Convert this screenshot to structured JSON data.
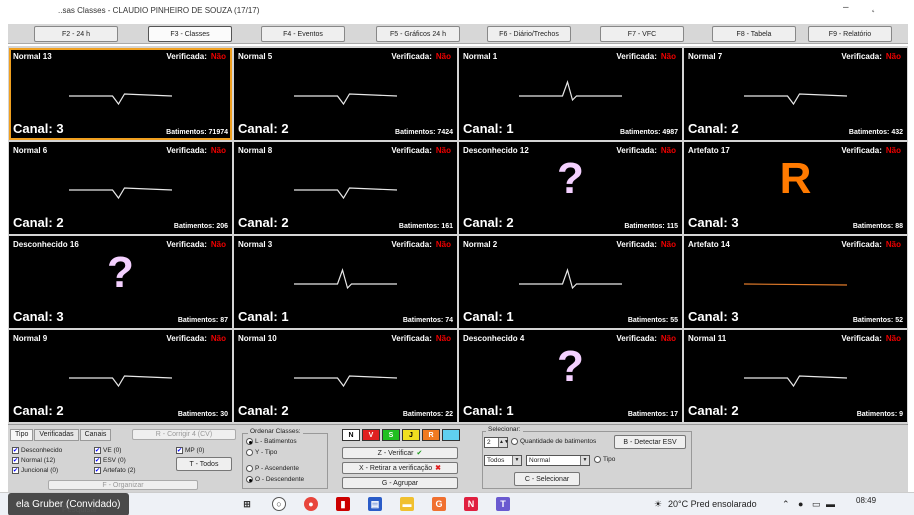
{
  "window": {
    "title": "..sas Classes - CLAUDIO PINHEIRO DE SOUZA (17/17)",
    "minimize": "–",
    "close": "˛"
  },
  "function_buttons": [
    {
      "label": "F2 - 24 h"
    },
    {
      "label": "F3 - Classes",
      "active": true
    },
    {
      "label": "F4 - Eventos"
    },
    {
      "label": "F5 - Gráficos 24 h"
    },
    {
      "label": "F6 - Diário/Trechos"
    },
    {
      "label": "F7 - VFC"
    },
    {
      "label": "F8 - Tabela"
    },
    {
      "label": "F9 - Relatório"
    }
  ],
  "cells": [
    {
      "type": "Normal 13",
      "verif_label": "Verificada:",
      "verif_value": "Não",
      "canal": "Canal: 3",
      "beats": "Batimentos: 71974",
      "wave": "dip",
      "selected": true
    },
    {
      "type": "Normal 5",
      "verif_label": "Verificada:",
      "verif_value": "Não",
      "canal": "Canal: 2",
      "beats": "Batimentos: 7424",
      "wave": "dip"
    },
    {
      "type": "Normal 1",
      "verif_label": "Verificada:",
      "verif_value": "Não",
      "canal": "Canal: 1",
      "beats": "Batimentos: 4987",
      "wave": "spike"
    },
    {
      "type": "Normal 7",
      "verif_label": "Verificada:",
      "verif_value": "Não",
      "canal": "Canal: 2",
      "beats": "Batimentos: 432",
      "wave": "dip"
    },
    {
      "type": "Normal 6",
      "verif_label": "Verificada:",
      "verif_value": "Não",
      "canal": "Canal: 2",
      "beats": "Batimentos: 206",
      "wave": "dip"
    },
    {
      "type": "Normal 8",
      "verif_label": "Verificada:",
      "verif_value": "Não",
      "canal": "Canal: 2",
      "beats": "Batimentos: 161",
      "wave": "dip"
    },
    {
      "type": "Desconhecido 12",
      "verif_label": "Verificada:",
      "verif_value": "Não",
      "canal": "Canal: 2",
      "beats": "Batimentos: 115",
      "symbol": "?",
      "symbol_color": "#f4d0ff"
    },
    {
      "type": "Artefato 17",
      "verif_label": "Verificada:",
      "verif_value": "Não",
      "canal": "Canal: 3",
      "beats": "Batimentos: 88",
      "symbol": "R",
      "symbol_color": "#ff7a00"
    },
    {
      "type": "Desconhecido 16",
      "verif_label": "Verificada:",
      "verif_value": "Não",
      "canal": "Canal: 3",
      "beats": "Batimentos: 87",
      "symbol": "?",
      "symbol_color": "#f4d0ff"
    },
    {
      "type": "Normal 3",
      "verif_label": "Verificada:",
      "verif_value": "Não",
      "canal": "Canal: 1",
      "beats": "Batimentos: 74",
      "wave": "spike"
    },
    {
      "type": "Normal 2",
      "verif_label": "Verificada:",
      "verif_value": "Não",
      "canal": "Canal: 1",
      "beats": "Batimentos: 55",
      "wave": "spike"
    },
    {
      "type": "Artefato 14",
      "verif_label": "Verificada:",
      "verif_value": "Não",
      "canal": "Canal: 3",
      "beats": "Batimentos: 52",
      "wave": "flat",
      "wave_color": "#e07a2a"
    },
    {
      "type": "Normal 9",
      "verif_label": "Verificada:",
      "verif_value": "Não",
      "canal": "Canal: 2",
      "beats": "Batimentos: 30",
      "wave": "dip"
    },
    {
      "type": "Normal 10",
      "verif_label": "Verificada:",
      "verif_value": "Não",
      "canal": "Canal: 2",
      "beats": "Batimentos: 22",
      "wave": "dip"
    },
    {
      "type": "Desconhecido 4",
      "verif_label": "Verificada:",
      "verif_value": "Não",
      "canal": "Canal: 1",
      "beats": "Batimentos: 17",
      "symbol": "?",
      "symbol_color": "#f4d0ff"
    },
    {
      "type": "Normal 11",
      "verif_label": "Verificada:",
      "verif_value": "Não",
      "canal": "Canal: 2",
      "beats": "Batimentos: 9",
      "wave": "dip"
    }
  ],
  "bottom": {
    "tabs": [
      "Tipo",
      "Verificadas",
      "Canais"
    ],
    "apply_all_label": "R - Corrigir 4 (CV)",
    "checks": [
      {
        "label": "Desconhecido",
        "checked": true
      },
      {
        "label": "Normal (12)",
        "checked": true
      },
      {
        "label": "Juncional (0)",
        "checked": true
      },
      {
        "label": "VE (0)",
        "checked": true
      },
      {
        "label": "ESV (0)",
        "checked": true
      },
      {
        "label": "Artefato (2)",
        "checked": true
      },
      {
        "label": "MP (0)",
        "checked": true
      }
    ],
    "todos_button": "T - Todos",
    "organize_button": "F - Organizar",
    "sort_group_label": "Ordenar Classes:",
    "sort_options": [
      {
        "label": "L - Batimentos",
        "on": true
      },
      {
        "label": "Y - Tipo",
        "on": false
      },
      {
        "label": "P - Ascendente",
        "on": false
      },
      {
        "label": "O - Descendente",
        "on": true
      }
    ],
    "color_buttons": [
      {
        "label": "N",
        "bg": "#ffffff",
        "fg": "#000000"
      },
      {
        "label": "V",
        "bg": "#e02020",
        "fg": "#ffffff"
      },
      {
        "label": "S",
        "bg": "#20c020",
        "fg": "#ffffff"
      },
      {
        "label": "J",
        "bg": "#f0e020",
        "fg": "#000000"
      },
      {
        "label": "R",
        "bg": "#f07a20",
        "fg": "#ffffff"
      },
      {
        "label": "",
        "bg": "#60d0f0",
        "fg": "#ffffff"
      }
    ],
    "verify_button": "Z - Verificar",
    "remove_verify_button": "X - Retirar a verificação",
    "group_button": "G - Agrupar",
    "select_group_label": "Selecionar:",
    "quantity_value": "2",
    "quantity_label": "Quantidade de batimentos",
    "detect_button": "B - Detectar ESV",
    "filter_all": "Todos",
    "filter_type": "Normal",
    "tipo_label": "Tipo",
    "select_button": "C - Selecionar"
  },
  "taskbar": {
    "guest_label": "ela Gruber (Convidado)",
    "search_label": "Pesquisar",
    "weather": "20°C  Pred ensolarado",
    "time": "08:49"
  }
}
